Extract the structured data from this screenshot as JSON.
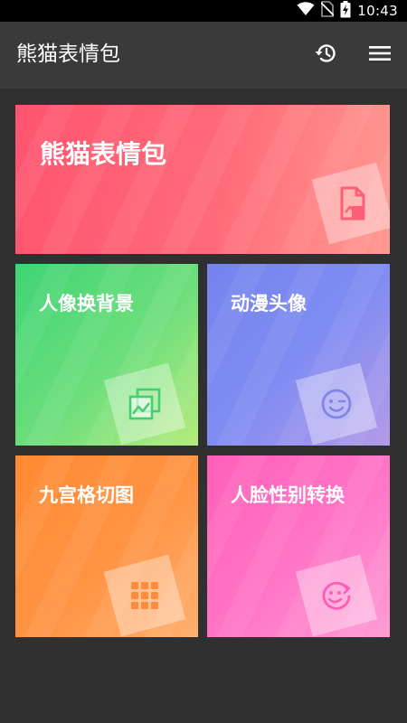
{
  "status_bar": {
    "time": "10:43",
    "icons": [
      "wifi-icon",
      "no-sim-icon",
      "battery-charging-icon"
    ]
  },
  "app_bar": {
    "title": "熊猫表情包",
    "actions": [
      "history-icon",
      "menu-icon"
    ]
  },
  "tiles": {
    "big": {
      "label": "熊猫表情包",
      "icon": "image-file-icon"
    },
    "bg_swap": {
      "label": "人像换背景",
      "icon": "gallery-icon"
    },
    "anime": {
      "label": "动漫头像",
      "icon": "wink-face-icon"
    },
    "grid": {
      "label": "九宫格切图",
      "icon": "grid-icon"
    },
    "face_swap": {
      "label": "人脸性别转换",
      "icon": "face-swap-icon"
    }
  },
  "colors": {
    "status_bar": "#000000",
    "app_bar": "#3a3a3a",
    "background": "#303030",
    "tile_red": "#ff5470",
    "tile_green": "#3fd474",
    "tile_blue": "#7584ee",
    "tile_orange": "#ff8a32",
    "tile_pink": "#ff5fb8"
  }
}
